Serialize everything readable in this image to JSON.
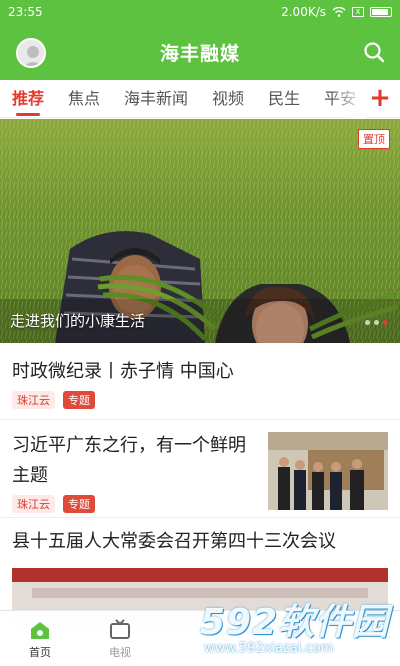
{
  "status_bar": {
    "time": "23:55",
    "speed": "2.00K/s",
    "sim_label": "X"
  },
  "header": {
    "title": "海丰融媒"
  },
  "tabs": [
    "推荐",
    "焦点",
    "海丰新闻",
    "视频",
    "民生",
    "平安"
  ],
  "banner": {
    "caption": "走进我们的小康生活",
    "badge": "置顶"
  },
  "news": [
    {
      "headline": "时政微纪录丨赤子情 中国心",
      "source": "珠江云",
      "tag": "专题"
    },
    {
      "headline": "习近平广东之行，有一个鲜明主题",
      "source": "珠江云",
      "tag": "专题"
    },
    {
      "headline": "县十五届人大常委会召开第四十三次会议"
    }
  ],
  "bottom_nav": [
    "首页",
    "电视"
  ],
  "watermark": {
    "brand": "592软件园",
    "url": "www.592xiazai.com"
  },
  "colors": {
    "primary": "#5cc23f",
    "accent": "#e23b2b"
  }
}
